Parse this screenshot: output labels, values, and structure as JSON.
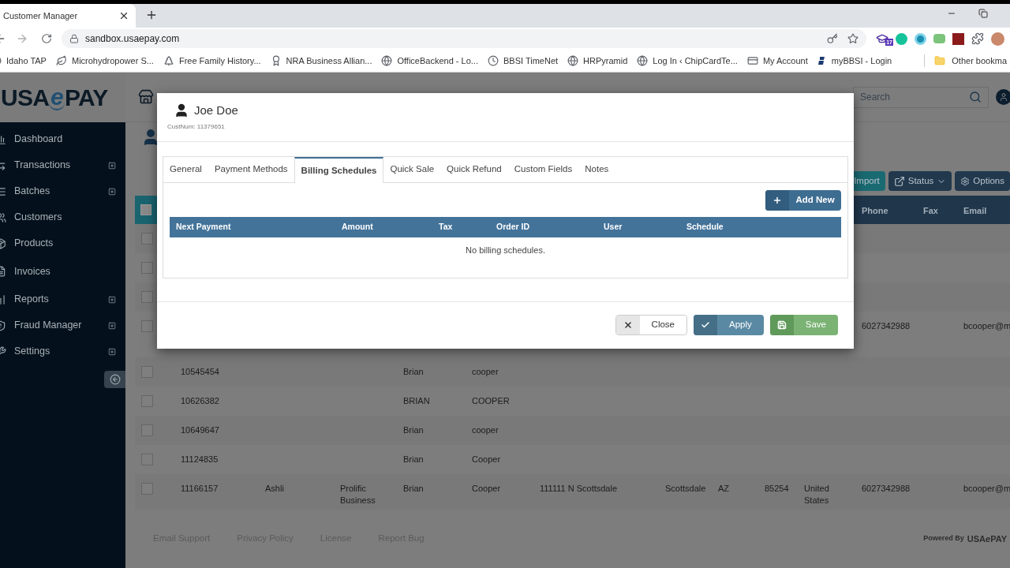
{
  "browser": {
    "tab_title": "Customer Manager",
    "url": "sandbox.usaepay.com",
    "extension_badge": "17",
    "bookmarks": [
      {
        "kind": "globe",
        "label": "Idaho TAP"
      },
      {
        "kind": "leaf",
        "label": "Microhydropower S..."
      },
      {
        "kind": "tree",
        "label": "Free Family History..."
      },
      {
        "kind": "seal",
        "label": "NRA Business Allian..."
      },
      {
        "kind": "globe",
        "label": "OfficeBackend - Lo..."
      },
      {
        "kind": "clock",
        "label": "BBSI TimeNet"
      },
      {
        "kind": "globe",
        "label": "HRPyramid"
      },
      {
        "kind": "globe",
        "label": "Log In ‹ ChipCardTe..."
      },
      {
        "kind": "card",
        "label": "My Account"
      },
      {
        "kind": "letter",
        "label": "myBBSI - Login"
      }
    ],
    "other_bookmarks": "Other bookma"
  },
  "logo": {
    "left": "USA",
    "mark": "e",
    "right": "PAY"
  },
  "sidebar": {
    "items": [
      {
        "kind": "chart",
        "label": "Dashboard",
        "expandable": false
      },
      {
        "kind": "arrows",
        "label": "Transactions",
        "expandable": true
      },
      {
        "kind": "list",
        "label": "Batches",
        "expandable": true
      },
      {
        "kind": "users",
        "label": "Customers",
        "expandable": false
      },
      {
        "kind": "box",
        "label": "Products",
        "expandable": false
      },
      {
        "kind": "file",
        "label": "Invoices",
        "expandable": false
      },
      {
        "kind": "bars",
        "label": "Reports",
        "expandable": true
      },
      {
        "kind": "shield",
        "label": "Fraud Manager",
        "expandable": true
      },
      {
        "kind": "wrench",
        "label": "Settings",
        "expandable": true
      }
    ]
  },
  "search": {
    "placeholder": "Search"
  },
  "toolbar": [
    {
      "kind": "import",
      "label": "Import"
    },
    {
      "kind": "status",
      "label": "Status"
    },
    {
      "kind": "options",
      "label": "Options"
    }
  ],
  "table": {
    "select_all_checked": false,
    "columns": [
      "Phone",
      "Fax",
      "Email"
    ],
    "rows": [
      {
        "checked": false,
        "cells": {}
      },
      {
        "checked": false,
        "cells": {}
      },
      {
        "checked": false,
        "cells": {}
      },
      {
        "checked": false,
        "cells": {
          "phone": "6027342988",
          "email": "bcooper@m"
        }
      },
      {
        "checked": false,
        "cells": {
          "number": "10545454",
          "first_name": "Brian",
          "last_name": "cooper"
        }
      },
      {
        "checked": false,
        "cells": {
          "number": "10626382",
          "first_name": "BRIAN",
          "last_name": "COOPER"
        }
      },
      {
        "checked": false,
        "cells": {
          "number": "10649647",
          "first_name": "Brian",
          "last_name": "cooper"
        }
      },
      {
        "checked": false,
        "cells": {
          "number": "11124835",
          "first_name": "Brian",
          "last_name": "Cooper"
        }
      },
      {
        "checked": false,
        "cells": {
          "number": "11166157",
          "column_2": "Ashli",
          "company": "Prolific Business",
          "first_name": "Brian",
          "last_name": "Cooper",
          "address": "111111 N Scottsdale",
          "city": "Scottsdale",
          "state": "AZ",
          "zip": "85254",
          "country": "United States",
          "phone": "6027342988",
          "email": "bcooper@m"
        }
      }
    ]
  },
  "modal": {
    "name": "Joe Doe",
    "cust_num": "CustNum: 11379651",
    "tabs": [
      {
        "label": "General",
        "selected": false
      },
      {
        "label": "Payment Methods",
        "selected": false
      },
      {
        "label": "Billing Schedules",
        "selected": true
      },
      {
        "label": "Quick Sale",
        "selected": false
      },
      {
        "label": "Quick Refund",
        "selected": false
      },
      {
        "label": "Custom Fields",
        "selected": false
      },
      {
        "label": "Notes",
        "selected": false
      }
    ],
    "add_button": "Add New",
    "columns": [
      "Next Payment",
      "Amount",
      "Tax",
      "Order ID",
      "User",
      "Schedule"
    ],
    "empty_text": "No billing schedules.",
    "buttons": [
      {
        "kind": "close",
        "label": "Close"
      },
      {
        "kind": "apply",
        "label": "Apply"
      },
      {
        "kind": "save",
        "label": "Save"
      }
    ]
  },
  "footer": {
    "links": [
      "Email Support",
      "Privacy Policy",
      "License",
      "Report Bug"
    ],
    "powered_by": "Powered By",
    "logo": {
      "left": "USA",
      "mark": "e",
      "right": "PAY"
    }
  }
}
